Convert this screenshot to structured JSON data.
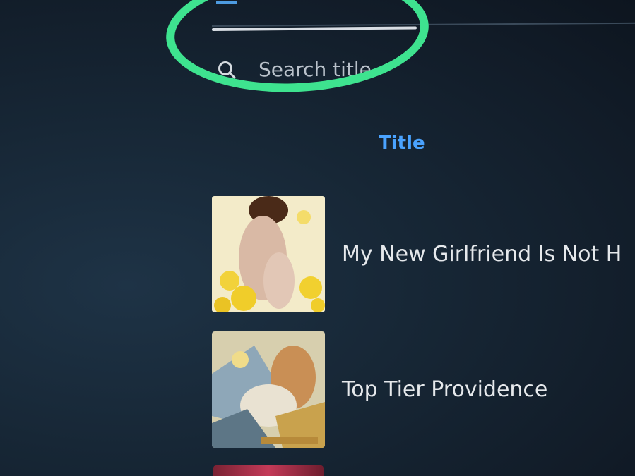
{
  "search": {
    "placeholder": "Search title"
  },
  "table": {
    "title_header": "Title"
  },
  "items": [
    {
      "title": "My New Girlfriend Is Not H"
    },
    {
      "title": "Top Tier Providence"
    }
  ],
  "colors": {
    "accent": "#4aa3ff",
    "highlight": "#3ee38f",
    "background": "#152333"
  }
}
